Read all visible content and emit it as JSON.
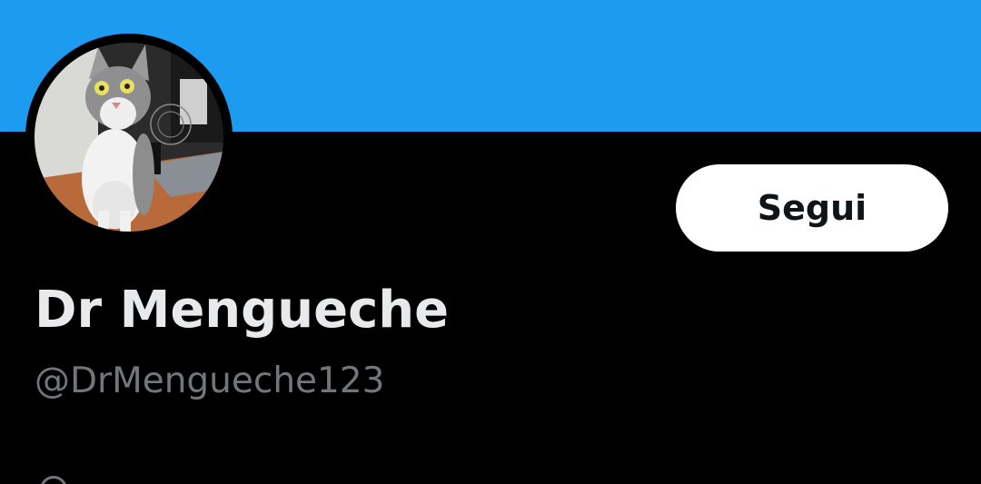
{
  "profile": {
    "display_name": "Dr Mengueche",
    "handle": "@DrMengueche123",
    "follow_label": "Segui",
    "avatar_icon": "cat-photo-avatar",
    "partial_icon": "location-icon"
  },
  "colors": {
    "banner": "#1d9bf0",
    "background": "#000000",
    "name_text": "#e7e9ea",
    "handle_text": "#71767b",
    "follow_bg": "#ffffff",
    "follow_text": "#0f1419"
  }
}
